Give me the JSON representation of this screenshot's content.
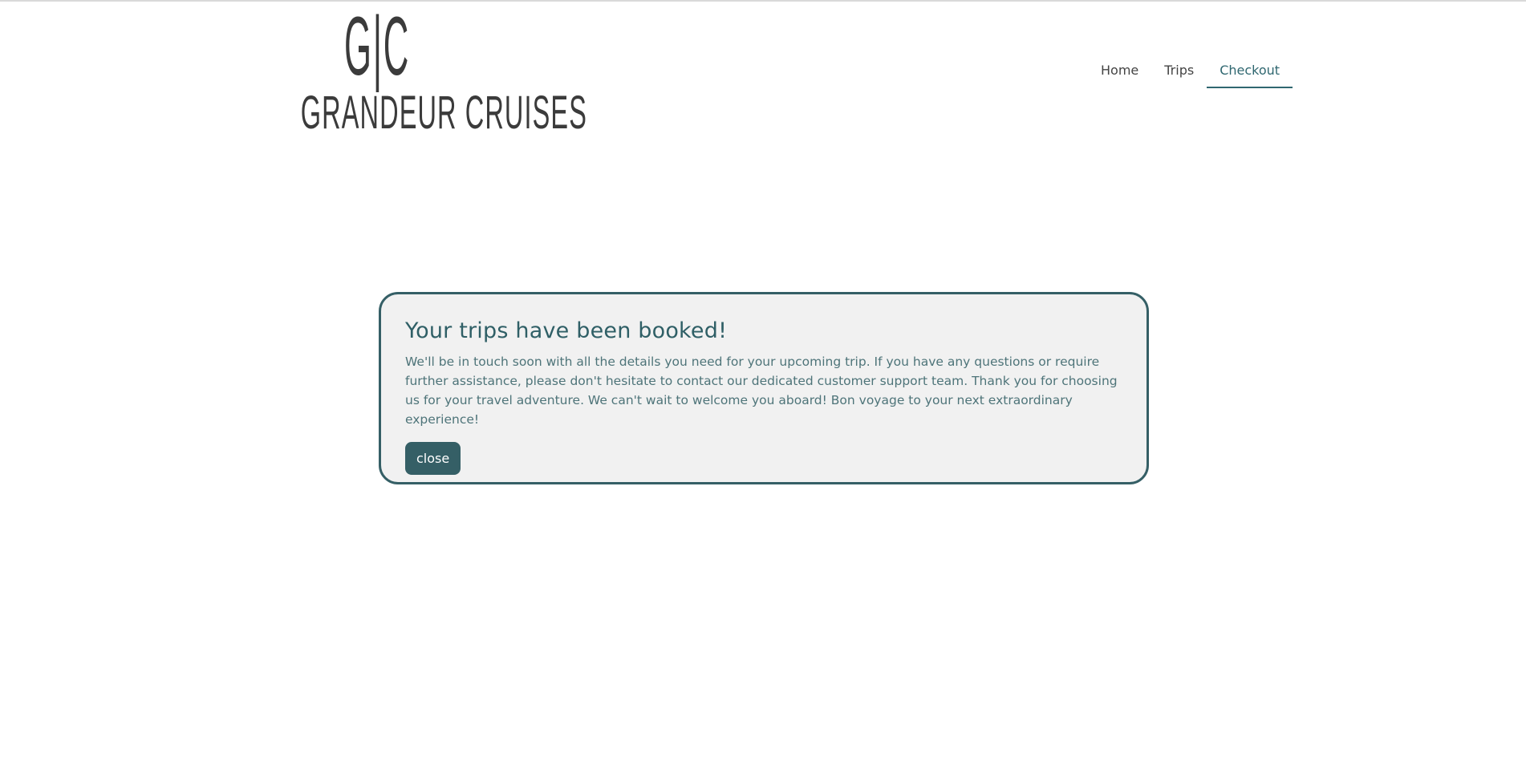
{
  "brand": {
    "monogram": "G|C",
    "wordmark": "GRANDEUR CRUISES"
  },
  "nav": {
    "items": [
      {
        "label": "Home",
        "active": false
      },
      {
        "label": "Trips",
        "active": false
      },
      {
        "label": "Checkout",
        "active": true
      }
    ]
  },
  "confirmation": {
    "title": "Your trips have been booked!",
    "message": "We'll be in touch soon with all the details you need for your upcoming trip. If you have any questions or require further assistance, please don't hesitate to contact our dedicated customer support team. Thank you for choosing us for your travel adventure. We can't wait to welcome you aboard! Bon voyage to your next extraordinary experience!",
    "close_label": "close"
  },
  "colors": {
    "accent": "#355f66",
    "card_background": "#f1f1f1",
    "nav_text": "#444444"
  }
}
